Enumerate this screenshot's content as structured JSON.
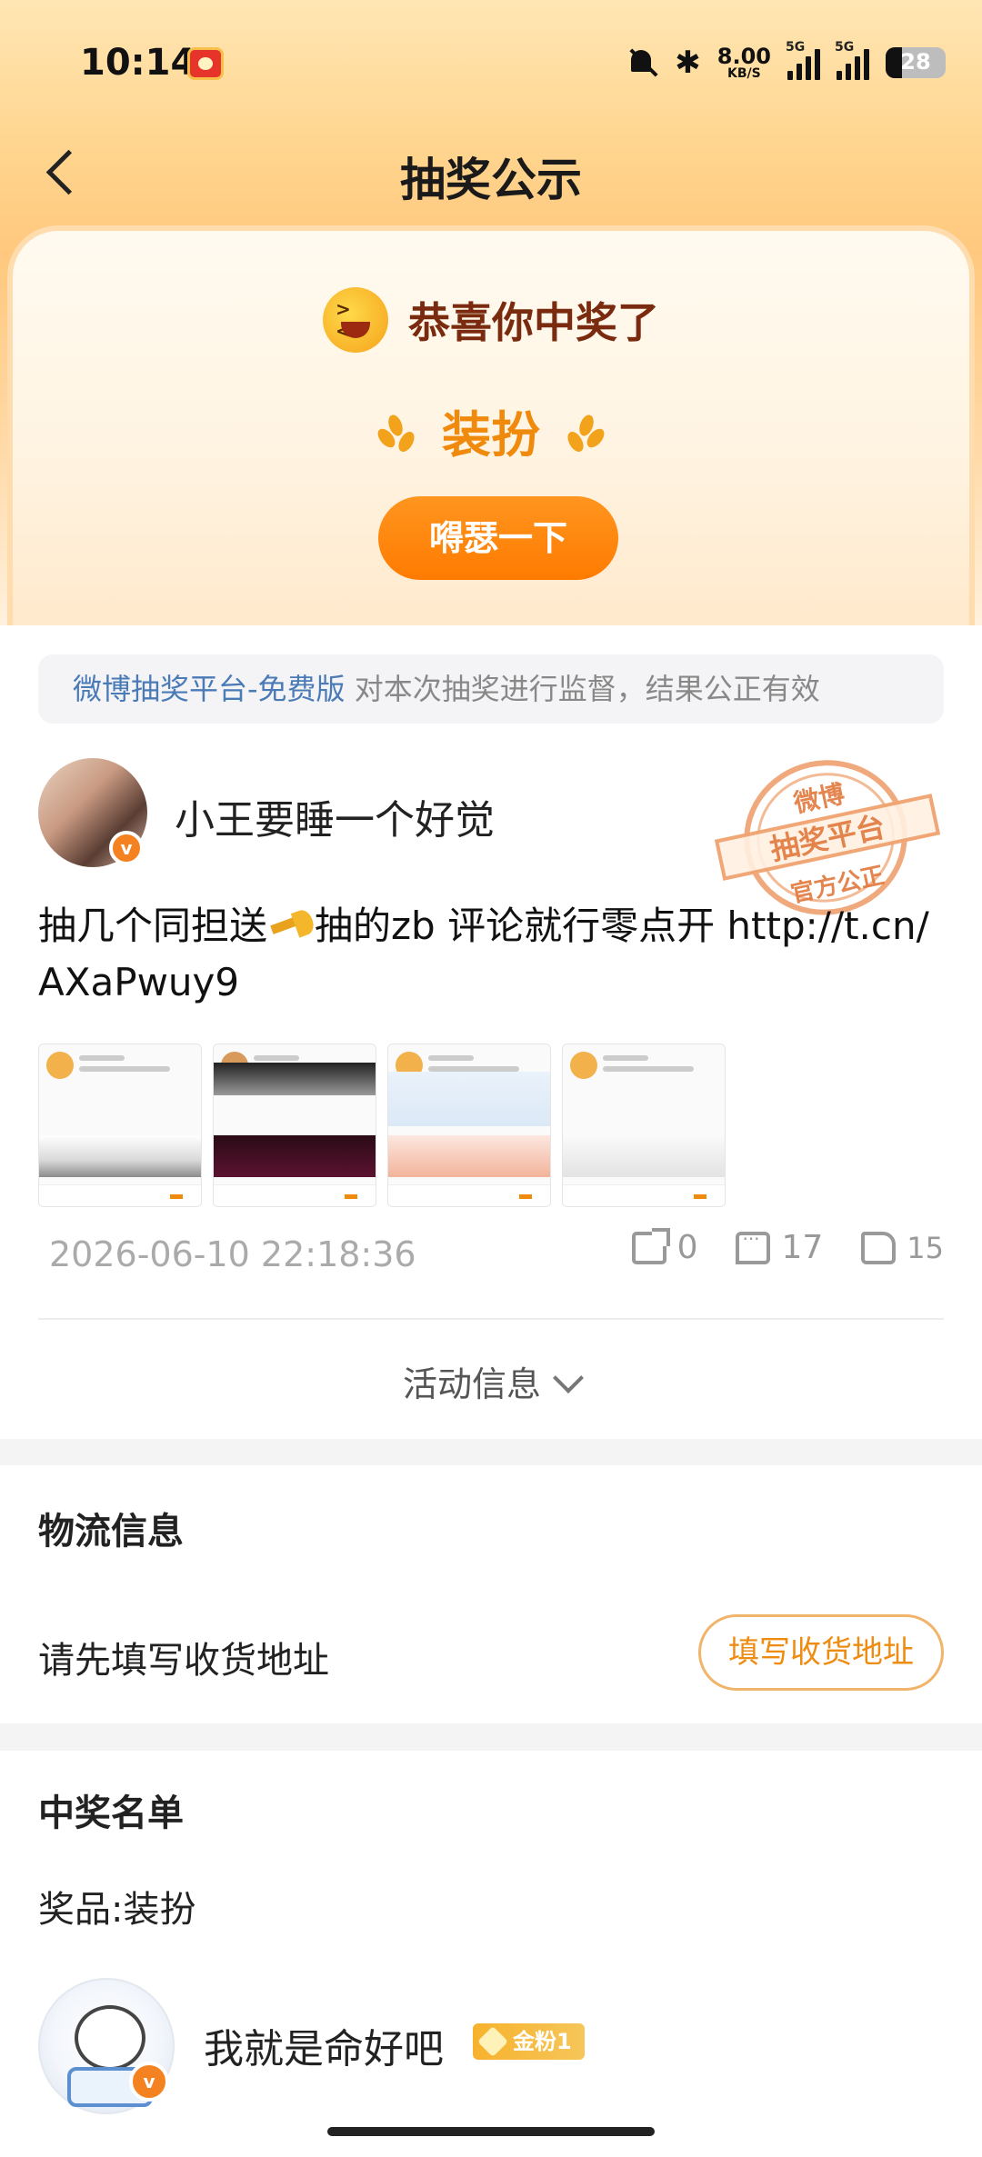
{
  "status_bar": {
    "time": "10:14",
    "net_speed": "8.00",
    "net_unit": "KB/S",
    "signal1_tag": "5G",
    "signal2_tag": "5G",
    "battery": "28",
    "icons": [
      "weibo-app-icon",
      "bell-muted-icon",
      "bluetooth-icon",
      "signal-icon",
      "signal-icon",
      "battery-icon"
    ]
  },
  "nav": {
    "title": "抽奖公示",
    "back_icon": "chevron-left-icon"
  },
  "prize_card": {
    "congrats": "恭喜你中奖了",
    "prize": "装扮",
    "button": "嘚瑟一下"
  },
  "notice": {
    "link_text": "微博抽奖平台-免费版",
    "text": " 对本次抽奖进行监督，结果公正有效"
  },
  "post": {
    "author": "小王要睡一个好觉",
    "stamp": {
      "top": "微博",
      "middle": "抽奖平台",
      "bottom": "官方公正"
    },
    "text_before": "抽几个同担送",
    "text_after": "抽的zb 评论就行零点开  http://t.cn/AXaPwuy9",
    "thumb_caption": "微博会员",
    "time": "2026-06-10 22:18:36",
    "shares": "0",
    "comments": "17",
    "likes": "15",
    "activity_info": "活动信息"
  },
  "logistics": {
    "title": "物流信息",
    "prompt": "请先填写收货地址",
    "button": "填写收货地址"
  },
  "winners": {
    "title": "中奖名单",
    "prize_label": "奖品:装扮",
    "items": [
      {
        "name": "我就是命好吧",
        "badge": "金粉1"
      }
    ]
  },
  "colors": {
    "accent": "#ff7b00",
    "link": "#4a7bb7",
    "gold": "#f7b22c"
  }
}
